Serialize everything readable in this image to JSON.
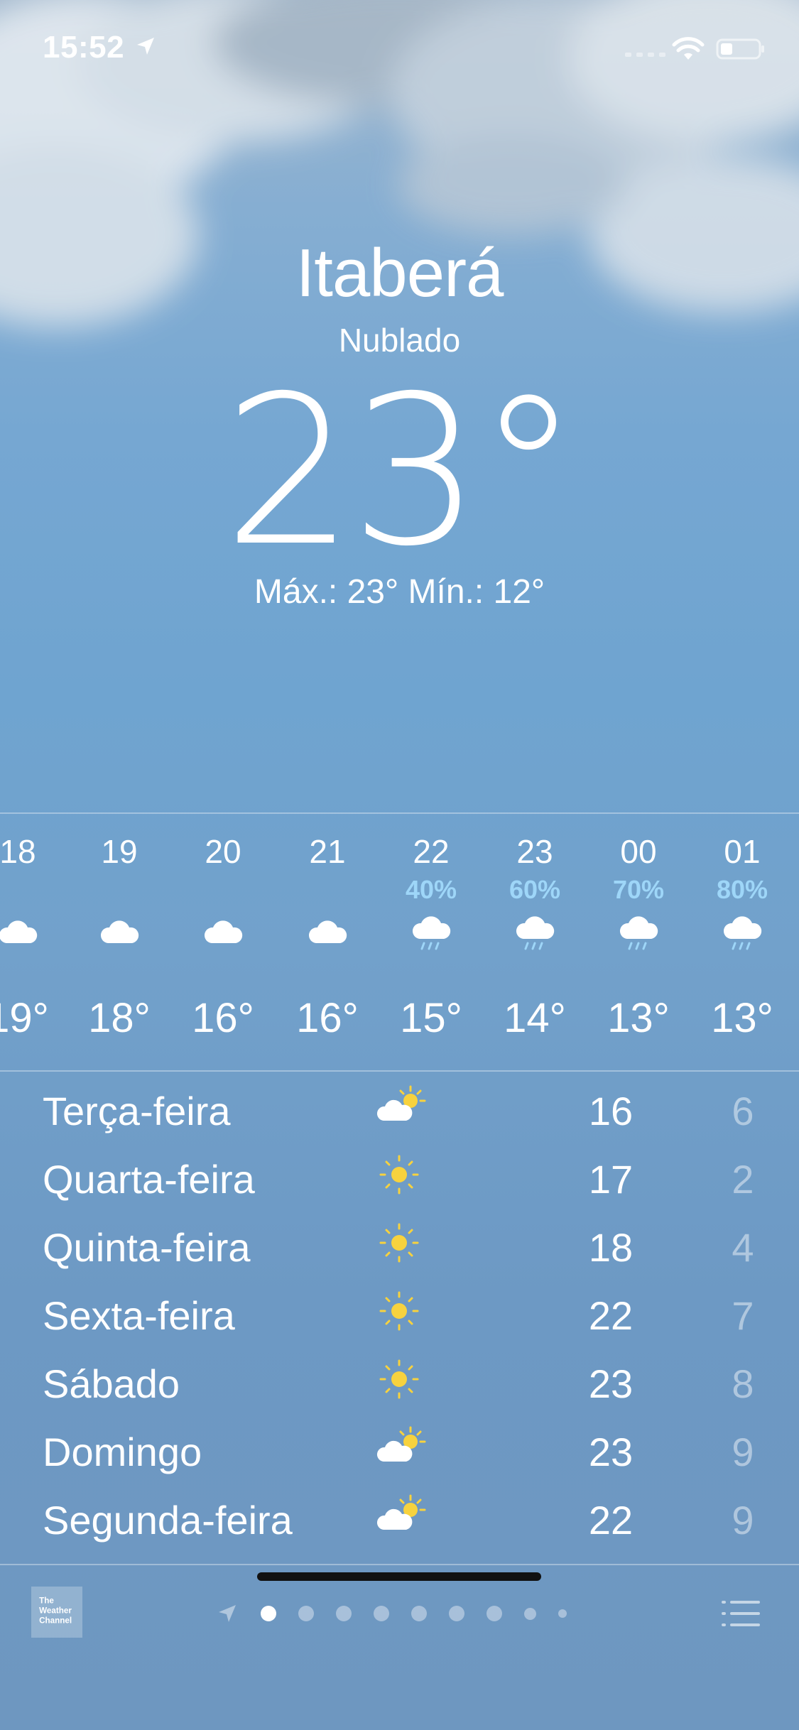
{
  "status_bar": {
    "time": "15:52"
  },
  "header": {
    "city": "Itaberá",
    "condition": "Nublado",
    "temperature": "23°",
    "high_low": "Máx.: 23° Mín.: 12°"
  },
  "hourly": [
    {
      "time": "18",
      "pop": "",
      "icon": "cloud-icon",
      "temp": "19°"
    },
    {
      "time": "19",
      "pop": "",
      "icon": "cloud-icon",
      "temp": "18°"
    },
    {
      "time": "20",
      "pop": "",
      "icon": "cloud-icon",
      "temp": "16°"
    },
    {
      "time": "21",
      "pop": "",
      "icon": "cloud-icon",
      "temp": "16°"
    },
    {
      "time": "22",
      "pop": "40%",
      "icon": "rain-cloud-icon",
      "temp": "15°"
    },
    {
      "time": "23",
      "pop": "60%",
      "icon": "rain-cloud-icon",
      "temp": "14°"
    },
    {
      "time": "00",
      "pop": "70%",
      "icon": "rain-cloud-icon",
      "temp": "13°"
    },
    {
      "time": "01",
      "pop": "80%",
      "icon": "rain-cloud-icon",
      "temp": "13°"
    }
  ],
  "daily": [
    {
      "day": "Terça-feira",
      "icon": "partly-sunny-icon",
      "high": "16",
      "low": "6"
    },
    {
      "day": "Quarta-feira",
      "icon": "sun-icon",
      "high": "17",
      "low": "2"
    },
    {
      "day": "Quinta-feira",
      "icon": "sun-icon",
      "high": "18",
      "low": "4"
    },
    {
      "day": "Sexta-feira",
      "icon": "sun-icon",
      "high": "22",
      "low": "7"
    },
    {
      "day": "Sábado",
      "icon": "sun-icon",
      "high": "23",
      "low": "8"
    },
    {
      "day": "Domingo",
      "icon": "partly-sunny-icon",
      "high": "23",
      "low": "9"
    },
    {
      "day": "Segunda-feira",
      "icon": "partly-sunny-icon",
      "high": "22",
      "low": "9"
    }
  ],
  "footer": {
    "provider_logo": "The Weather Channel",
    "page_count": 9,
    "active_page": 1
  },
  "colors": {
    "precip": "#9ed6f8",
    "sun": "#f7d23e"
  }
}
